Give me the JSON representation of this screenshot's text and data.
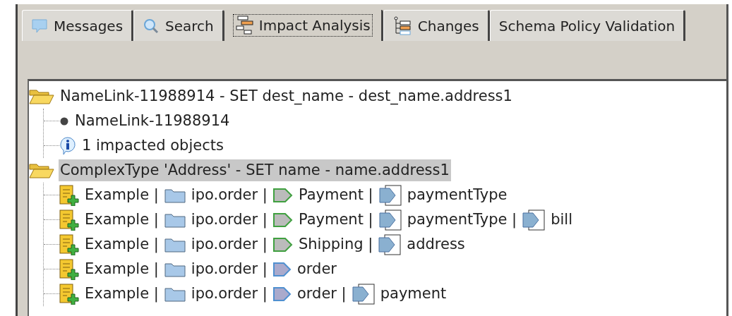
{
  "tabs": [
    {
      "label": "Messages",
      "kind": "messages",
      "selected": false
    },
    {
      "label": "Search",
      "kind": "search",
      "selected": false
    },
    {
      "label": "Impact Analysis",
      "kind": "impact",
      "selected": true
    },
    {
      "label": "Changes",
      "kind": "changes",
      "selected": false
    },
    {
      "label": "Schema Policy Validation",
      "kind": "plain",
      "selected": false
    }
  ],
  "tree": [
    {
      "kind": "folder",
      "expanded": true,
      "selected": false,
      "label": "NameLink-11988914 - SET dest_name - dest_name.address1",
      "children": [
        {
          "kind": "bullet",
          "label": "NameLink-11988914"
        },
        {
          "kind": "info",
          "label": "1 impacted objects"
        }
      ]
    },
    {
      "kind": "folder",
      "expanded": true,
      "selected": true,
      "label": "ComplexType 'Address' - SET name - name.address1",
      "children": [
        {
          "kind": "example",
          "segments": [
            {
              "text": "Example |"
            },
            {
              "kind": "package",
              "text": "ipo.order |"
            },
            {
              "kind": "group",
              "text": "Payment |"
            },
            {
              "kind": "complex",
              "text": "paymentType"
            }
          ]
        },
        {
          "kind": "example",
          "segments": [
            {
              "text": "Example |"
            },
            {
              "kind": "package",
              "text": "ipo.order |"
            },
            {
              "kind": "group",
              "text": "Payment |"
            },
            {
              "kind": "complex",
              "text": "paymentType |"
            },
            {
              "kind": "complex",
              "text": "bill"
            }
          ]
        },
        {
          "kind": "example",
          "segments": [
            {
              "text": "Example |"
            },
            {
              "kind": "package",
              "text": "ipo.order |"
            },
            {
              "kind": "group",
              "text": "Shipping |"
            },
            {
              "kind": "complex",
              "text": "address"
            }
          ]
        },
        {
          "kind": "example",
          "segments": [
            {
              "text": "Example |"
            },
            {
              "kind": "package",
              "text": "ipo.order |"
            },
            {
              "kind": "element",
              "text": "order"
            }
          ]
        },
        {
          "kind": "example",
          "segments": [
            {
              "text": "Example |"
            },
            {
              "kind": "package",
              "text": "ipo.order |"
            },
            {
              "kind": "element",
              "text": "order |"
            },
            {
              "kind": "complex",
              "text": "payment"
            }
          ]
        }
      ]
    }
  ]
}
